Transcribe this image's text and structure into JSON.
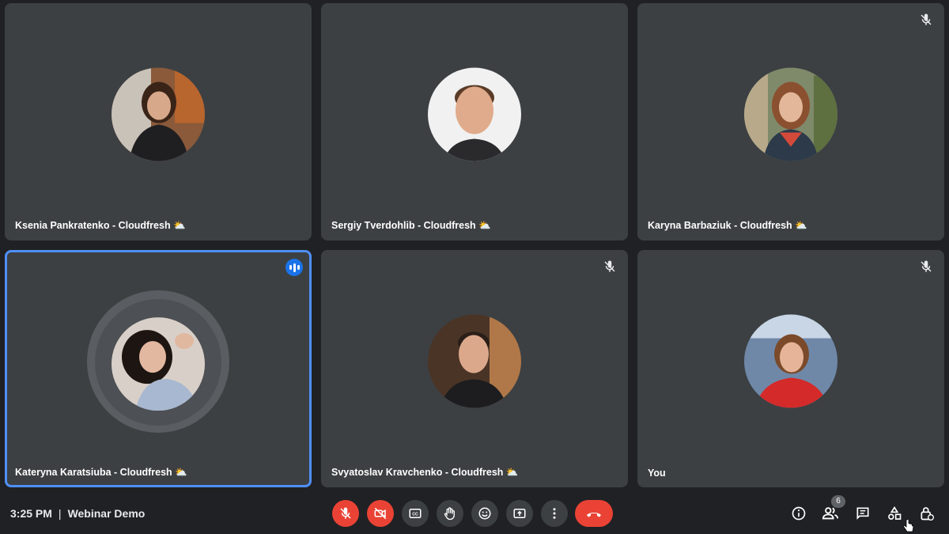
{
  "participants": [
    {
      "name": "Ksenia Pankratenko - Cloudfresh ⛅",
      "muted": false,
      "speaking": false
    },
    {
      "name": "Sergiy Tverdohlib - Cloudfresh ⛅",
      "muted": false,
      "speaking": false
    },
    {
      "name": "Karyna Barbaziuk - Cloudfresh ⛅",
      "muted": true,
      "speaking": false
    },
    {
      "name": "Kateryna Karatsiuba - Cloudfresh ⛅",
      "muted": false,
      "speaking": true
    },
    {
      "name": "Svyatoslav Kravchenko - Cloudfresh ⛅",
      "muted": true,
      "speaking": false
    },
    {
      "name": "You",
      "muted": true,
      "speaking": false
    }
  ],
  "meeting": {
    "time": "3:25 PM",
    "separator": "|",
    "title": "Webinar Demo"
  },
  "controls": {
    "mic": "mic-off-icon",
    "camera": "camera-off-icon",
    "captions": "CC",
    "raise_hand": "hand-icon",
    "reactions": "emoji-icon",
    "present": "present-icon",
    "more": "more-vert-icon",
    "hangup": "call-end-icon"
  },
  "right_controls": {
    "people_count": "6"
  },
  "colors": {
    "background": "#202124",
    "tile": "#3c4043",
    "accent": "#1a73e8",
    "speaking_border": "#4f8ff7",
    "danger": "#ea4335"
  }
}
